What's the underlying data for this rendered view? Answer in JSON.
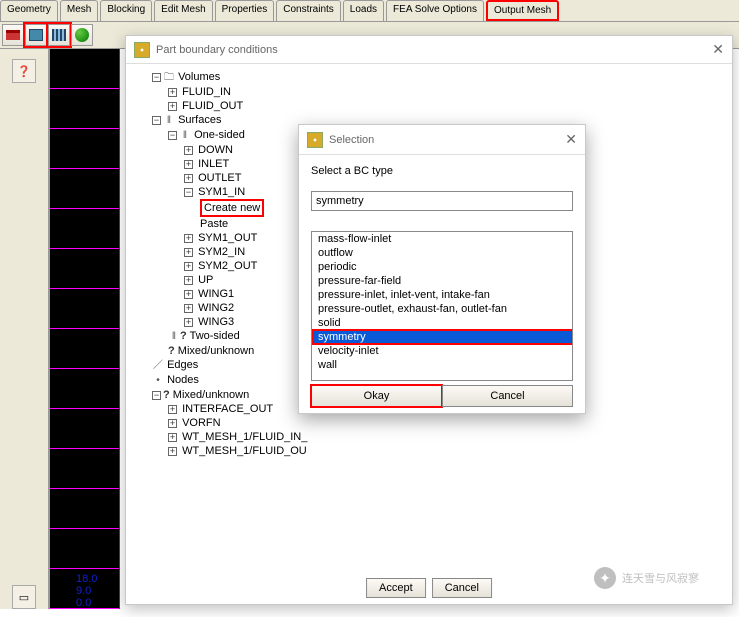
{
  "tabs": {
    "geometry": "Geometry",
    "mesh": "Mesh",
    "blocking": "Blocking",
    "editmesh": "Edit Mesh",
    "properties": "Properties",
    "constraints": "Constraints",
    "loads": "Loads",
    "feasolve": "FEA Solve Options",
    "outputmesh": "Output Mesh"
  },
  "part_dialog": {
    "title": "Part boundary conditions",
    "accept": "Accept",
    "cancel": "Cancel"
  },
  "tree": {
    "volumes": "Volumes",
    "fluid_in": "FLUID_IN",
    "fluid_out": "FLUID_OUT",
    "surfaces": "Surfaces",
    "one_sided": "One-sided",
    "down": "DOWN",
    "inlet": "INLET",
    "outlet": "OUTLET",
    "sym1_in": "SYM1_IN",
    "create_new": "Create new",
    "paste": "Paste",
    "sym1_out": "SYM1_OUT",
    "sym2_in": "SYM2_IN",
    "sym2_out": "SYM2_OUT",
    "up": "UP",
    "wing1": "WING1",
    "wing2": "WING2",
    "wing3": "WING3",
    "two_sided": "Two-sided",
    "mixed_unknown": "Mixed/unknown",
    "edges": "Edges",
    "nodes": "Nodes",
    "mixed_unknown2": "Mixed/unknown",
    "interface_out": "INTERFACE_OUT",
    "vorfn": "VORFN",
    "wt1": "WT_MESH_1/FLUID_IN_",
    "wt2": "WT_MESH_1/FLUID_OU"
  },
  "selection": {
    "title": "Selection",
    "prompt": "Select a BC type",
    "current": "symmetry",
    "options": [
      "mass-flow-inlet",
      "outflow",
      "periodic",
      "pressure-far-field",
      "pressure-inlet, inlet-vent, intake-fan",
      "pressure-outlet, exhaust-fan, outlet-fan",
      "solid",
      "symmetry",
      "velocity-inlet",
      "wall"
    ],
    "okay": "Okay",
    "cancel": "Cancel"
  },
  "numbers": {
    "a": "18.0",
    "b": "9.0",
    "c": "0.0"
  },
  "watermark": {
    "text": "连天雪与风寂寥"
  }
}
